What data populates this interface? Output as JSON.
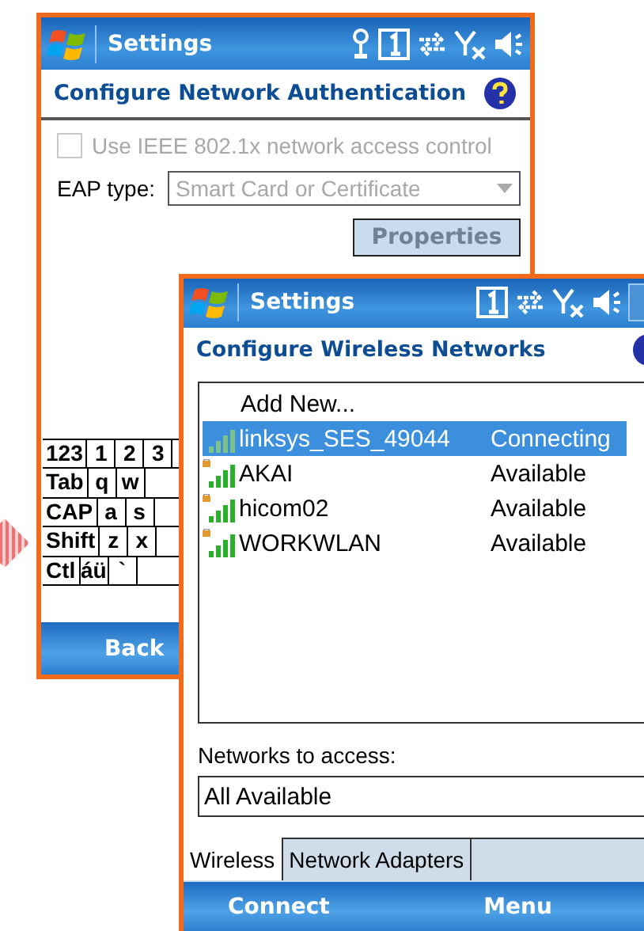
{
  "auth_window": {
    "title": "Settings",
    "header": "Configure Network Authentication",
    "ieee_checkbox": {
      "label": "Use IEEE 802.1x network access control",
      "checked": false,
      "disabled": true
    },
    "eap_label": "EAP type:",
    "eap_dropdown": {
      "value": "Smart Card or Certificate",
      "disabled": true
    },
    "properties_button": {
      "label": "Properties",
      "disabled": true
    },
    "keyboard": [
      [
        "123",
        "1",
        "2",
        "3"
      ],
      [
        "Tab",
        "q",
        "w"
      ],
      [
        "CAP",
        "a",
        "s"
      ],
      [
        "Shift",
        "z",
        "x"
      ],
      [
        "Ctl",
        "áü",
        "`"
      ]
    ],
    "softkey": "Back"
  },
  "wireless_window": {
    "title": "Settings",
    "header": "Configure Wireless Networks",
    "add_new": "Add New...",
    "networks": [
      {
        "name": "linksys_SES_49044",
        "status": "Connecting",
        "selected": true,
        "secured": false
      },
      {
        "name": "AKAI",
        "status": "Available",
        "selected": false,
        "secured": true
      },
      {
        "name": "hicom02",
        "status": "Available",
        "selected": false,
        "secured": true
      },
      {
        "name": "WORKWLAN",
        "status": "Available",
        "selected": false,
        "secured": true
      }
    ],
    "access_label": "Networks to access:",
    "access_dropdown": {
      "value": "All Available"
    },
    "tabs": [
      {
        "label": "Wireless",
        "selected": true
      },
      {
        "label": "Network Adapters",
        "selected": false
      }
    ],
    "softkeys": [
      "Connect",
      "Menu"
    ]
  }
}
